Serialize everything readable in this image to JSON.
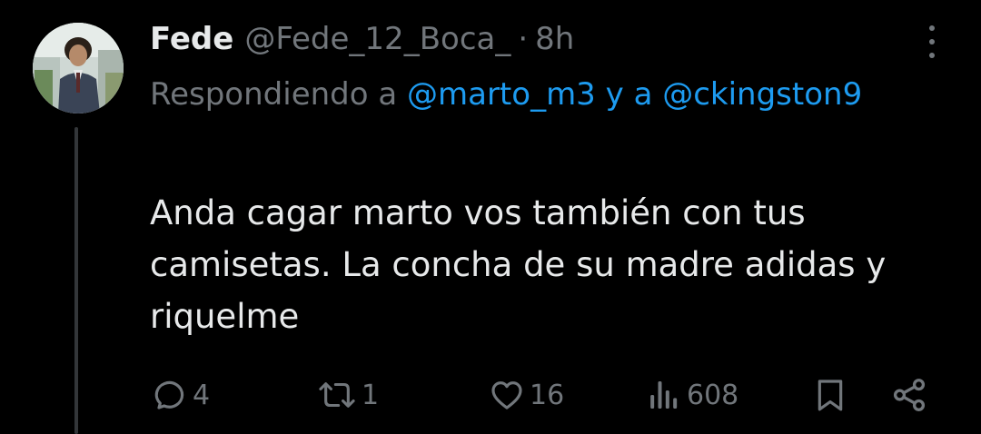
{
  "tweet": {
    "display_name": "Fede",
    "handle": "@Fede_12_Boca_",
    "separator": "·",
    "time": "8h",
    "reply": {
      "prefix": "Respondiendo a",
      "mention1": "@marto_m3",
      "joiner": "y a",
      "mention2": "@ckingston9"
    },
    "text": "Anda cagar marto vos también con tus camisetas. La concha de su madre adidas y riquelme"
  },
  "stats": {
    "replies": "4",
    "retweets": "1",
    "likes": "16",
    "views": "608"
  },
  "icons": {
    "reply": "reply-icon",
    "retweet": "retweet-icon",
    "like": "heart-icon",
    "views": "views-icon",
    "bookmark": "bookmark-icon",
    "share": "share-icon",
    "more": "more-icon"
  },
  "colors": {
    "background": "#000000",
    "text": "#e7e9ea",
    "secondary": "#71767b",
    "link": "#1d9bf0",
    "thread_line": "#333639"
  }
}
